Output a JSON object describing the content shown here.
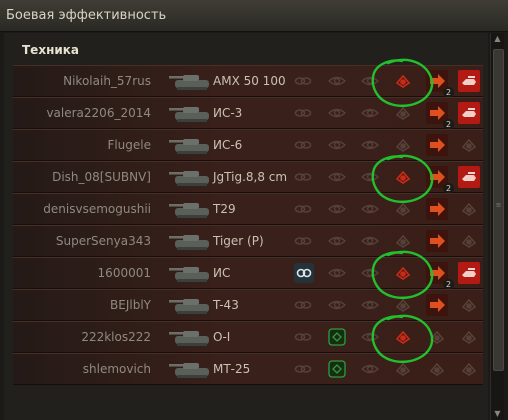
{
  "window": {
    "title": "Боевая эффективность"
  },
  "section": {
    "title": "Техника"
  },
  "rows": [
    {
      "player": "Nikolaih_57rus",
      "vehicle": "AMX 50 100",
      "icons": {
        "damage": true,
        "damage_active": true,
        "crit": true,
        "crit_badge": "2",
        "kill": true
      }
    },
    {
      "player": "valera2206_2014",
      "vehicle": "ИС-3",
      "icons": {
        "damage": false,
        "crit": true,
        "crit_badge": "2",
        "kill": true
      }
    },
    {
      "player": "Flugele",
      "vehicle": "ИС-6",
      "icons": {
        "damage": false,
        "crit": true,
        "crit_badge": "",
        "kill": false
      }
    },
    {
      "player": "Dish_08[SUBNV]",
      "vehicle": "JgTig.8,8 cm",
      "icons": {
        "damage": true,
        "damage_active": true,
        "crit": true,
        "crit_badge": "2",
        "kill": true
      }
    },
    {
      "player": "denisvsemogushii",
      "vehicle": "T29",
      "icons": {
        "damage": false,
        "crit": true,
        "crit_badge": "",
        "kill": false
      }
    },
    {
      "player": "SuperSenya343",
      "vehicle": "Tiger (P)",
      "icons": {
        "damage": false,
        "crit": true,
        "crit_badge": "",
        "kill": false
      }
    },
    {
      "player": "1600001",
      "vehicle": "ИС",
      "icons": {
        "damage": true,
        "damage_active": true,
        "crit": true,
        "crit_badge": "2",
        "kill": true,
        "spot": true
      }
    },
    {
      "player": "BEJlblY",
      "vehicle": "T-43",
      "icons": {
        "damage": false,
        "crit": true,
        "crit_badge": "",
        "kill": false
      }
    },
    {
      "player": "222klos222",
      "vehicle": "О-I",
      "icons": {
        "damage": true,
        "damage_active": true,
        "crit": false,
        "kill": false,
        "assist": true
      }
    },
    {
      "player": "shlemovich",
      "vehicle": "МТ-25",
      "icons": {
        "damage": false,
        "crit": false,
        "kill": false,
        "assist": true
      }
    }
  ],
  "colors": {
    "damage": "#cc2a16",
    "crit": "#e0501e",
    "kill": "#b41a14",
    "assist": "#2aa033",
    "spot": "#dfe6e8",
    "annotation": "#22c02c"
  },
  "icon_names": {
    "damage": "damage-dealt-icon",
    "crit": "critical-hit-icon",
    "kill": "destroyed-icon",
    "assist": "assist-icon",
    "spot": "spotted-icon"
  }
}
